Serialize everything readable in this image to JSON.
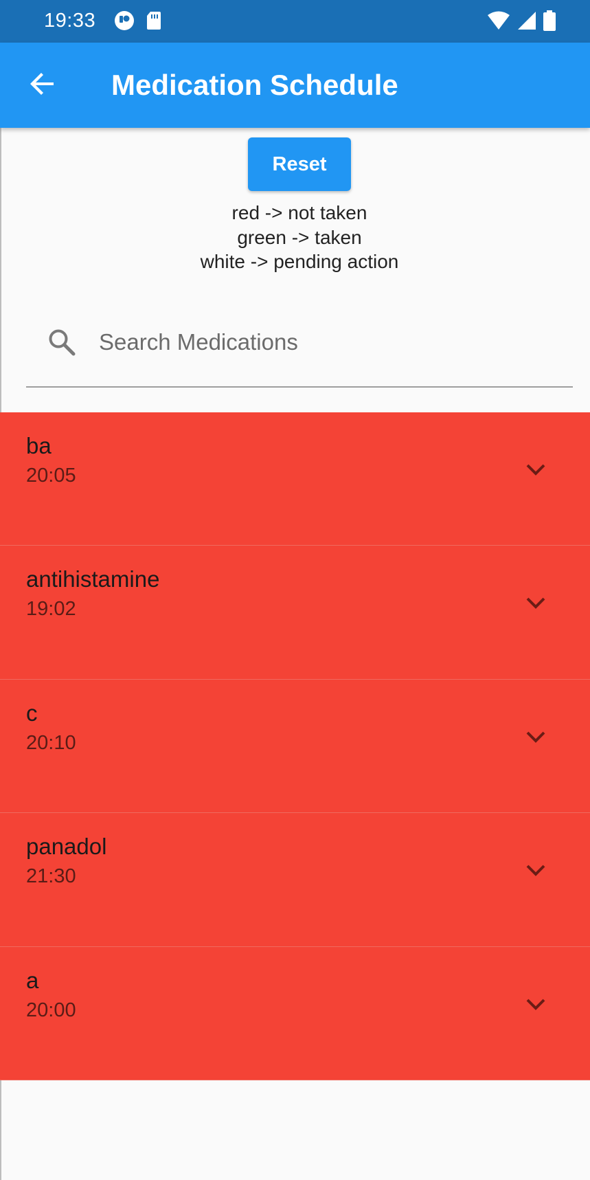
{
  "status_bar": {
    "time": "19:33",
    "icons": [
      "app-notification-icon",
      "sd-card-icon",
      "wifi-icon",
      "signal-icon",
      "battery-icon"
    ]
  },
  "app_bar": {
    "back_icon": "arrow-back-icon",
    "title": "Medication Schedule"
  },
  "reset_label": "Reset",
  "legend": [
    "red -> not taken",
    "green -> taken",
    "white -> pending action"
  ],
  "search": {
    "placeholder": "Search Medications",
    "value": ""
  },
  "medications": [
    {
      "name": "ba",
      "time": "20:05",
      "status": "not taken"
    },
    {
      "name": "antihistamine",
      "time": "19:02",
      "status": "not taken"
    },
    {
      "name": "c",
      "time": "20:10",
      "status": "not taken"
    },
    {
      "name": "panadol",
      "time": "21:30",
      "status": "not taken"
    },
    {
      "name": "a",
      "time": "20:00",
      "status": "not taken"
    }
  ],
  "colors": {
    "status_bar": "#1a6fb5",
    "app_bar": "#2196f3",
    "not_taken": "#f44336",
    "background": "#fafafa"
  }
}
